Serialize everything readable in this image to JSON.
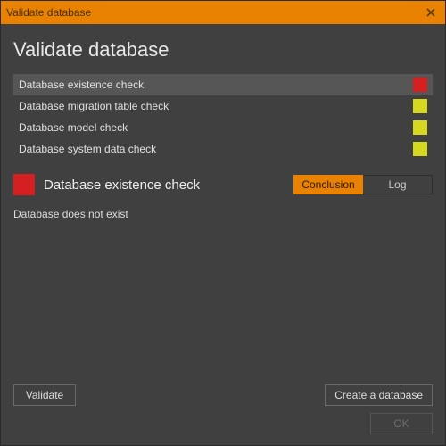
{
  "window": {
    "title": "Validate database"
  },
  "heading": "Validate database",
  "checks": [
    {
      "label": "Database existence check",
      "status": "red",
      "selected": true
    },
    {
      "label": "Database migration table check",
      "status": "yellow",
      "selected": false
    },
    {
      "label": "Database model check",
      "status": "yellow",
      "selected": false
    },
    {
      "label": "Database system data check",
      "status": "yellow",
      "selected": false
    }
  ],
  "detail": {
    "status": "red",
    "title": "Database existence check",
    "tabs": {
      "conclusion": "Conclusion",
      "log": "Log",
      "active": "conclusion"
    },
    "body": "Database does not exist"
  },
  "buttons": {
    "validate": "Validate",
    "create": "Create a database",
    "ok": "OK"
  },
  "colors": {
    "accent": "#e88200",
    "red": "#d42020",
    "yellow": "#d6d820"
  }
}
